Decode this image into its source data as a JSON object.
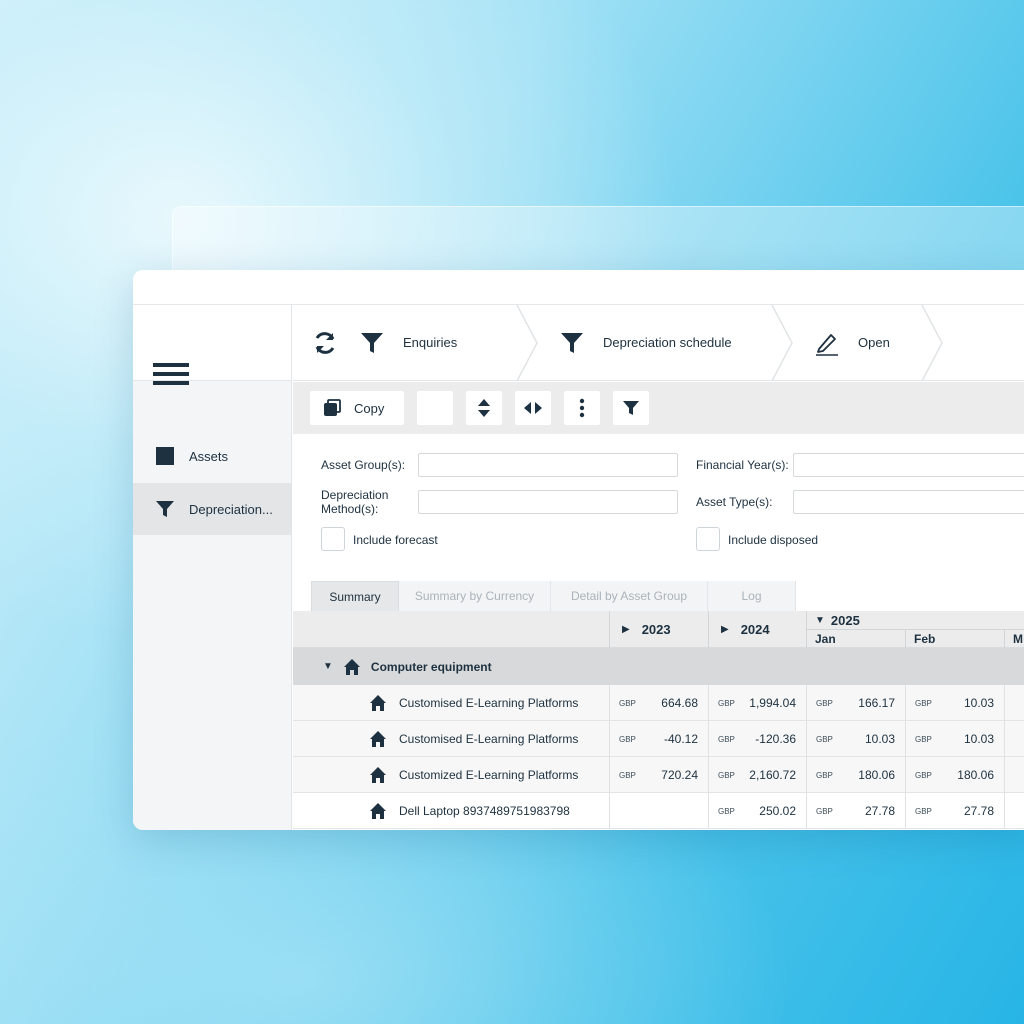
{
  "breadcrumb": {
    "refresh_icon": "refresh-icon",
    "items": [
      {
        "label": "Enquiries",
        "icon": "filter-icon"
      },
      {
        "label": "Depreciation schedule",
        "icon": "filter-icon"
      },
      {
        "label": "Open",
        "icon": "pencil-icon"
      }
    ]
  },
  "sidebar": {
    "items": [
      {
        "label": "Assets",
        "icon": "square-icon"
      },
      {
        "label": "Depreciation...",
        "icon": "filter-icon",
        "active": true
      }
    ]
  },
  "toolbar": {
    "copy_label": "Copy"
  },
  "filters": {
    "asset_groups_label": "Asset Group(s):",
    "financial_year_label": "Financial Year(s):",
    "depreciation_method_label_line1": "Depreciation",
    "depreciation_method_label_line2": "Method(s):",
    "asset_types_label": "Asset Type(s):",
    "include_forecast_label": "Include forecast",
    "include_disposed_label": "Include disposed"
  },
  "tabs": [
    "Summary",
    "Summary by Currency",
    "Detail by Asset Group",
    "Log"
  ],
  "grid": {
    "headers": {
      "y2023": "2023",
      "y2024": "2024",
      "y2025": "2025",
      "jan": "Jan",
      "feb": "Feb",
      "mar": "M"
    },
    "group": "Computer equipment",
    "rows": [
      {
        "name": "Customised E-Learning Platforms",
        "c2023": "GBP",
        "v2023": "664.68",
        "c2024": "GBP",
        "v2024": "1,994.04",
        "cjan": "GBP",
        "vjan": "166.17",
        "cfeb": "GBP",
        "vfeb": "10.03"
      },
      {
        "name": "Customised E-Learning Platforms",
        "c2023": "GBP",
        "v2023": "-40.12",
        "c2024": "GBP",
        "v2024": "-120.36",
        "cjan": "GBP",
        "vjan": "10.03",
        "cfeb": "GBP",
        "vfeb": "10.03"
      },
      {
        "name": "Customized E-Learning Platforms",
        "c2023": "GBP",
        "v2023": "720.24",
        "c2024": "GBP",
        "v2024": "2,160.72",
        "cjan": "GBP",
        "vjan": "180.06",
        "cfeb": "GBP",
        "vfeb": "180.06"
      },
      {
        "name": "Dell Laptop 8937489751983798",
        "c2023": "",
        "v2023": "",
        "c2024": "GBP",
        "v2024": "250.02",
        "cjan": "GBP",
        "vjan": "27.78",
        "cfeb": "GBP",
        "vfeb": "27.78"
      }
    ]
  }
}
